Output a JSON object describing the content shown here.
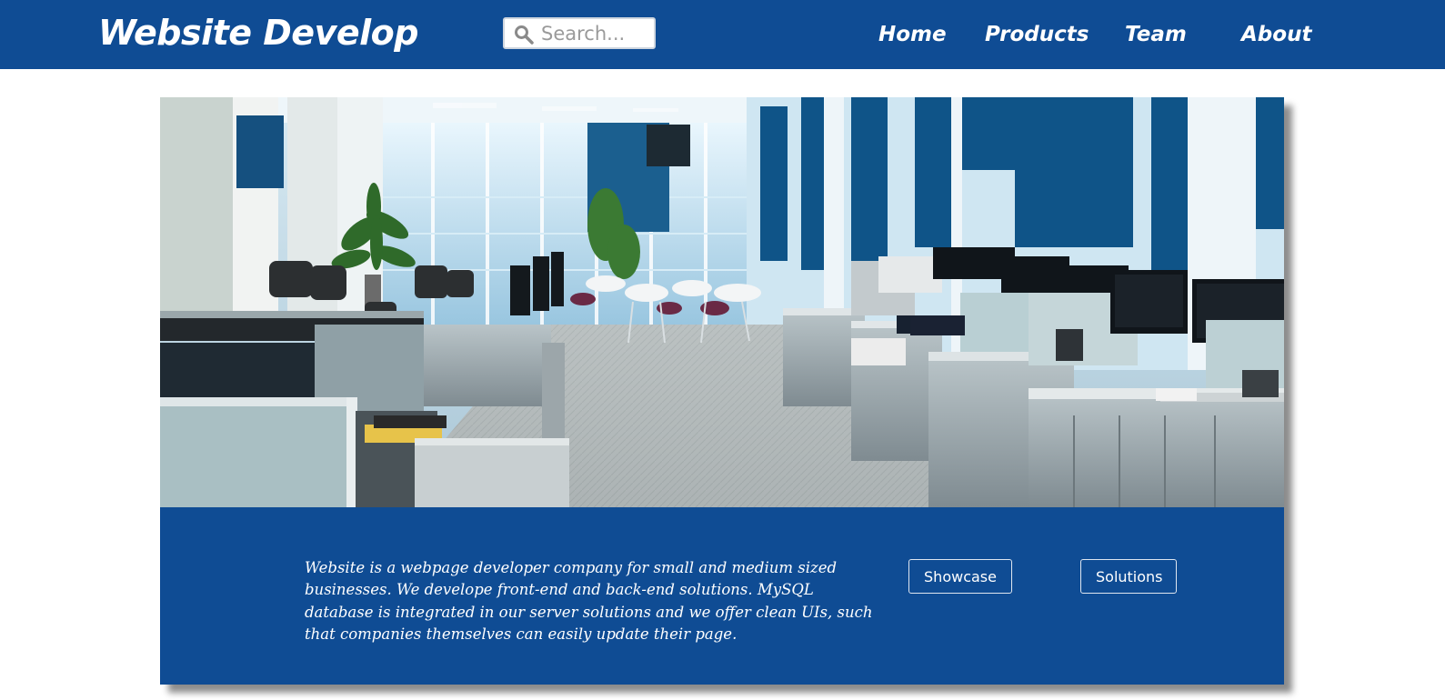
{
  "header": {
    "logo_text": "Website Develop",
    "search": {
      "placeholder": "Search...",
      "value": ""
    },
    "nav": [
      {
        "label": "Home"
      },
      {
        "label": "Products"
      },
      {
        "label": "Team"
      },
      {
        "label": "About"
      }
    ]
  },
  "hero": {
    "image_icon": "office-photo",
    "image_subject": "open-plan office interior"
  },
  "info": {
    "description": "Website is a webpage developer company for small and medium sized businesses. We develope front-end and back-end solutions. MySQL database is integrated in our server solutions and we offer clean UIs, such that companies themselves can easily update their page.",
    "buttons": [
      {
        "label": "Showcase"
      },
      {
        "label": "Solutions"
      }
    ]
  },
  "colors": {
    "brand_blue": "#0f4c94",
    "background": "#ffffff",
    "text_on_brand": "#ffffff"
  }
}
